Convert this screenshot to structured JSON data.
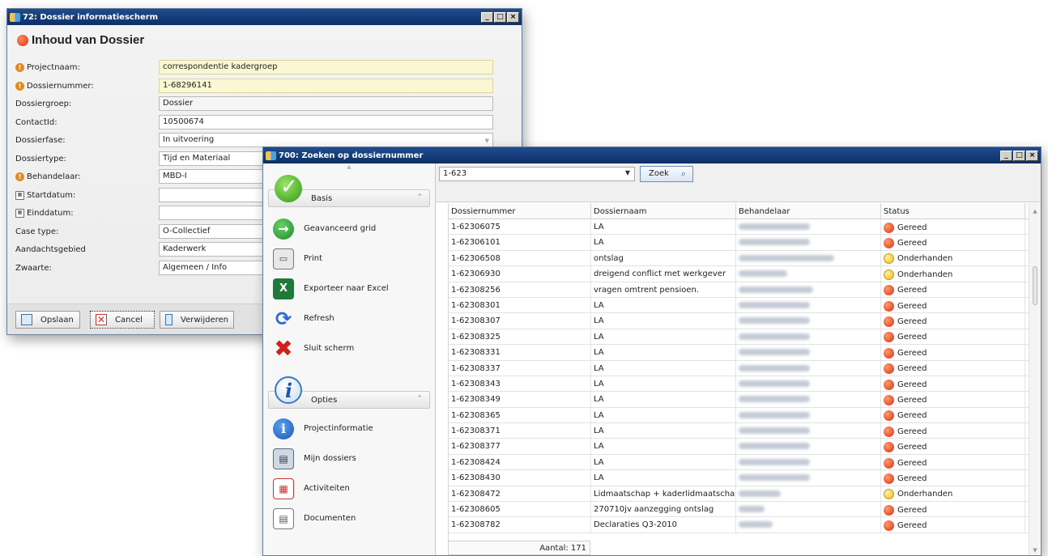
{
  "window1": {
    "title": "72: Dossier informatiescherm",
    "heading": "Inhoud van Dossier",
    "fields": [
      {
        "label": "Projectnaam:",
        "value": "correspondentie kadergroep",
        "icon": "warning-icon"
      },
      {
        "label": "Dossiernummer:",
        "value": "1-68296141",
        "icon": "warning-icon"
      },
      {
        "label": "Dossiergroep:",
        "value": "Dossier",
        "icon": ""
      },
      {
        "label": "ContactId:",
        "value": "10500674",
        "icon": ""
      },
      {
        "label": "Dossierfase:",
        "value": "In uitvoering",
        "icon": ""
      },
      {
        "label": "Dossiertype:",
        "value": "Tijd en Materiaal",
        "icon": ""
      },
      {
        "label": "Behandelaar:",
        "value": "MBD-I",
        "icon": "warning-icon"
      },
      {
        "label": "Startdatum:",
        "value": "",
        "icon": "calendar-icon"
      },
      {
        "label": "Einddatum:",
        "value": "",
        "icon": "calendar-icon"
      },
      {
        "label": "Case type:",
        "value": "O-Collectief",
        "icon": ""
      },
      {
        "label": "Aandachtsgebied",
        "value": "Kaderwerk",
        "icon": ""
      },
      {
        "label": "Zwaarte:",
        "value": "Algemeen / Info",
        "icon": ""
      }
    ],
    "buttons": {
      "save": "Opslaan",
      "cancel": "Cancel",
      "delete": "Verwijderen"
    }
  },
  "window2": {
    "title": "700: Zoeken op dossiernummer",
    "sidebar": {
      "group_basis": "Basis",
      "basis_items": [
        "Geavanceerd grid",
        "Print",
        "Exporteer naar Excel",
        "Refresh",
        "Sluit scherm"
      ],
      "group_opties": "Opties",
      "opties_items": [
        "Projectinformatie",
        "Mijn dossiers",
        "Activiteiten",
        "Documenten"
      ]
    },
    "search": {
      "value": "1-623",
      "button": "Zoek"
    },
    "columns": [
      "Dossiernummer",
      "Dossiernaam",
      "Behandelaar",
      "Status"
    ],
    "rows": [
      {
        "nr": "1-62306075",
        "naam": "LA",
        "status": "Gereed"
      },
      {
        "nr": "1-62306101",
        "naam": "LA",
        "status": "Gereed"
      },
      {
        "nr": "1-62306508",
        "naam": "ontslag",
        "status": "Onderhanden"
      },
      {
        "nr": "1-62306930",
        "naam": "dreigend conflict met werkgever",
        "status": "Onderhanden"
      },
      {
        "nr": "1-62308256",
        "naam": "vragen omtrent pensioen.",
        "status": "Gereed"
      },
      {
        "nr": "1-62308301",
        "naam": "LA",
        "status": "Gereed"
      },
      {
        "nr": "1-62308307",
        "naam": "LA",
        "status": "Gereed"
      },
      {
        "nr": "1-62308325",
        "naam": "LA",
        "status": "Gereed"
      },
      {
        "nr": "1-62308331",
        "naam": "LA",
        "status": "Gereed"
      },
      {
        "nr": "1-62308337",
        "naam": "LA",
        "status": "Gereed"
      },
      {
        "nr": "1-62308343",
        "naam": "LA",
        "status": "Gereed"
      },
      {
        "nr": "1-62308349",
        "naam": "LA",
        "status": "Gereed"
      },
      {
        "nr": "1-62308365",
        "naam": "LA",
        "status": "Gereed"
      },
      {
        "nr": "1-62308371",
        "naam": "LA",
        "status": "Gereed"
      },
      {
        "nr": "1-62308377",
        "naam": "LA",
        "status": "Gereed"
      },
      {
        "nr": "1-62308424",
        "naam": "LA",
        "status": "Gereed"
      },
      {
        "nr": "1-62308430",
        "naam": "LA",
        "status": "Gereed"
      },
      {
        "nr": "1-62308472",
        "naam": "Lidmaatschap + kaderlidmaatschap",
        "status": "Onderhanden"
      },
      {
        "nr": "1-62308605",
        "naam": "270710jv aanzegging ontslag",
        "status": "Gereed"
      },
      {
        "nr": "1-62308782",
        "naam": "Declaraties Q3-2010",
        "status": "Gereed"
      }
    ],
    "count": "Aantal: 171",
    "status_colors": {
      "Gereed": "#dd2e0c",
      "Onderhanden": "#f0b91a"
    }
  }
}
